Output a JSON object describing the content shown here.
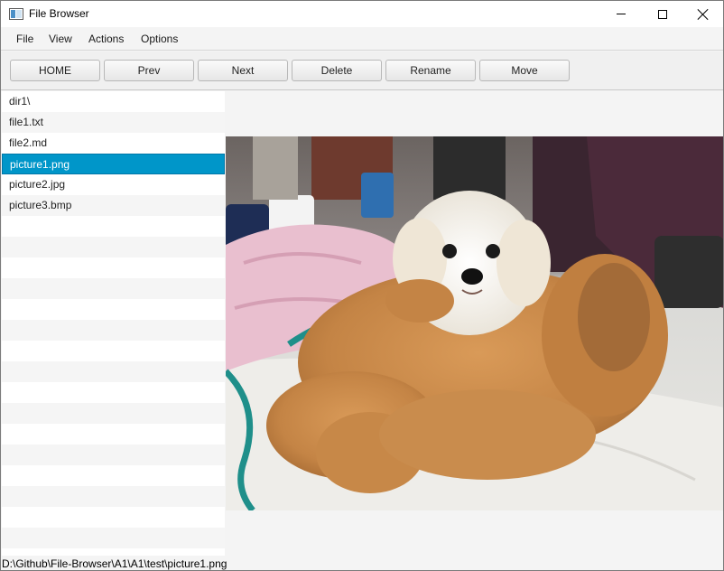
{
  "window": {
    "title": "File Browser",
    "icon": "app-window-icon"
  },
  "window_controls": {
    "minimize": "minimize-icon",
    "maximize": "maximize-icon",
    "close": "close-icon"
  },
  "menu": {
    "items": [
      "File",
      "View",
      "Actions",
      "Options"
    ]
  },
  "toolbar": {
    "buttons": [
      "HOME",
      "Prev",
      "Next",
      "Delete",
      "Rename",
      "Move"
    ]
  },
  "files": {
    "items": [
      "dir1\\",
      "file1.txt",
      "file2.md",
      "picture1.png",
      "picture2.jpg",
      "picture3.bmp"
    ],
    "selected": "picture1.png"
  },
  "preview": {
    "description": "photo of a small white puppy lying on a brown plush teddy bear on a marble table"
  },
  "status": {
    "path": "D:\\Github\\File-Browser\\A1\\A1\\test\\picture1.png"
  },
  "colors": {
    "selection": "#0096c9",
    "selection_text": "#ffffff",
    "alt_row": "#f5f5f5"
  }
}
